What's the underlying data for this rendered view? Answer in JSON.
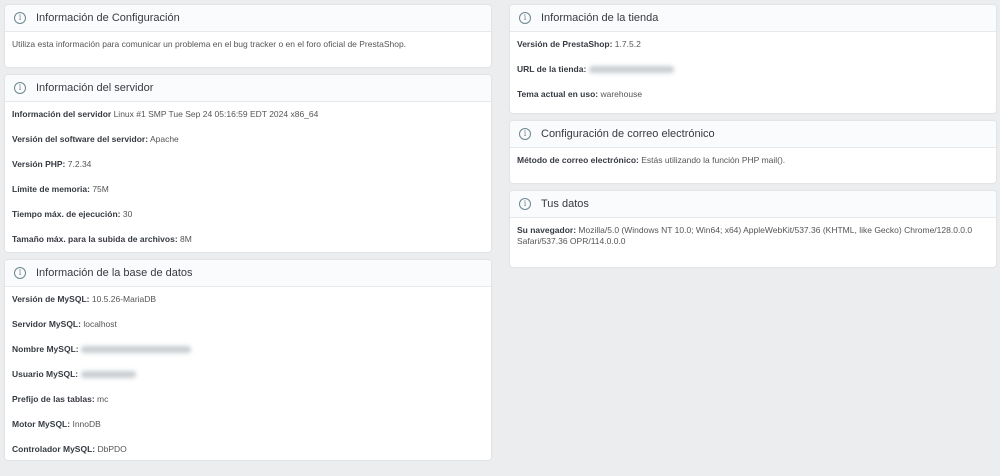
{
  "config": {
    "title": "Información de Configuración",
    "text": "Utiliza esta información para comunicar un problema en el bug tracker o en el foro oficial de PrestaShop."
  },
  "server": {
    "title": "Información del servidor",
    "rows": [
      {
        "label": "Información del servidor",
        "value": "Linux #1 SMP Tue Sep 24 05:16:59 EDT 2024 x86_64"
      },
      {
        "label": "Versión del software del servidor:",
        "value": "Apache"
      },
      {
        "label": "Versión PHP:",
        "value": "7.2.34"
      },
      {
        "label": "Límite de memoria:",
        "value": "75M"
      },
      {
        "label": "Tiempo máx. de ejecución:",
        "value": "30"
      },
      {
        "label": "Tamaño máx. para la subida de archivos:",
        "value": "8M"
      }
    ]
  },
  "db": {
    "title": "Información de la base de datos",
    "rows": [
      {
        "label": "Versión de MySQL:",
        "value": "10.5.26-MariaDB"
      },
      {
        "label": "Servidor MySQL:",
        "value": "localhost"
      },
      {
        "label": "Nombre MySQL:",
        "value": null
      },
      {
        "label": "Usuario MySQL:",
        "value": null
      },
      {
        "label": "Prefijo de las tablas:",
        "value": "mc"
      },
      {
        "label": "Motor MySQL:",
        "value": "InnoDB"
      },
      {
        "label": "Controlador MySQL:",
        "value": "DbPDO"
      }
    ]
  },
  "store": {
    "title": "Información de la tienda",
    "rows": [
      {
        "label": "Versión de PrestaShop:",
        "value": "1.7.5.2"
      },
      {
        "label": "URL de la tienda:",
        "value": null
      },
      {
        "label": "Tema actual en uso:",
        "value": "warehouse"
      }
    ]
  },
  "mail": {
    "title": "Configuración de correo electrónico",
    "rows": [
      {
        "label": "Método de correo electrónico:",
        "value": "Estás utilizando la función PHP mail()."
      }
    ]
  },
  "you": {
    "title": "Tus datos",
    "rows": [
      {
        "label": "Su navegador:",
        "value": "Mozilla/5.0 (Windows NT 10.0; Win64; x64) AppleWebKit/537.36 (KHTML, like Gecko) Chrome/128.0.0.0 Safari/537.36 OPR/114.0.0.0"
      }
    ]
  }
}
